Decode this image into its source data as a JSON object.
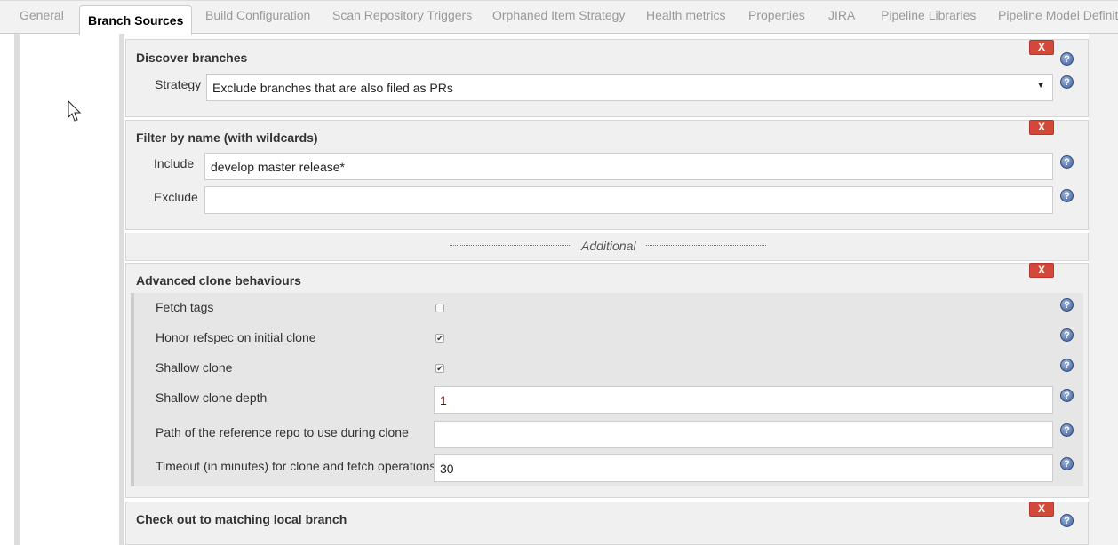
{
  "tabs": [
    "General",
    "Branch Sources",
    "Build Configuration",
    "Scan Repository Triggers",
    "Orphaned Item Strategy",
    "Health metrics",
    "Properties",
    "JIRA",
    "Pipeline Libraries",
    "Pipeline Model Definition"
  ],
  "active_tab": "Branch Sources",
  "delete_label": "X",
  "help_glyph": "?",
  "discover": {
    "title": "Discover branches",
    "strategy_label": "Strategy",
    "strategy_value": "Exclude branches that are also filed as PRs"
  },
  "filter": {
    "title": "Filter by name (with wildcards)",
    "include_label": "Include",
    "include_value": "develop master release*",
    "exclude_label": "Exclude",
    "exclude_value": ""
  },
  "additional": "Additional",
  "clone": {
    "title": "Advanced clone behaviours",
    "fetch_tags": "Fetch tags",
    "fetch_tags_checked": false,
    "honor_refspec": "Honor refspec on initial clone",
    "honor_refspec_checked": true,
    "shallow": "Shallow clone",
    "shallow_checked": true,
    "depth_label": "Shallow clone depth",
    "depth_value": "1",
    "ref_label": "Path of the reference repo to use during clone",
    "ref_value": "",
    "timeout_label": "Timeout (in minutes) for clone and fetch operations",
    "timeout_value": "30"
  },
  "checkout": {
    "title": "Check out to matching local branch"
  },
  "colors": {
    "delete": "#d24939",
    "panel": "#f0f0f0"
  }
}
